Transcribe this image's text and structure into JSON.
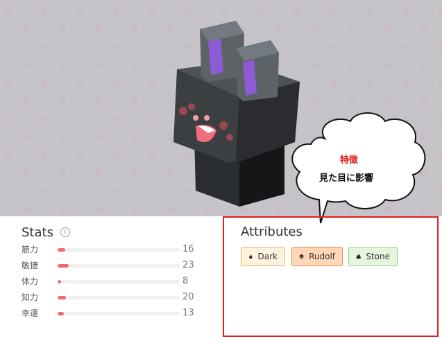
{
  "hero": {
    "character": "stone-rabbit"
  },
  "stats": {
    "title": "Stats",
    "info_icon": "info-icon",
    "items": [
      {
        "label": "筋力",
        "value": "16",
        "fill": 0.06
      },
      {
        "label": "敏捷",
        "value": "23",
        "fill": 0.09
      },
      {
        "label": "体力",
        "value": "8",
        "fill": 0.03
      },
      {
        "label": "知力",
        "value": "20",
        "fill": 0.07
      },
      {
        "label": "幸運",
        "value": "13",
        "fill": 0.05
      }
    ],
    "bar_color": "#ef6b6b"
  },
  "attributes": {
    "title": "Attributes",
    "chips": [
      {
        "label": "Dark",
        "icon": "dark-icon",
        "bg": "#fff2de",
        "border": "#f3b25c"
      },
      {
        "label": "Rudolf",
        "icon": "rudolf-icon",
        "bg": "#ffd7b8",
        "border": "#f08c44"
      },
      {
        "label": "Stone",
        "icon": "stone-icon",
        "bg": "#e6f6de",
        "border": "#8fd07a"
      }
    ],
    "highlight_color": "#e41c1c"
  },
  "callout": {
    "line1": "特徴",
    "line2": "見た目に影響"
  }
}
